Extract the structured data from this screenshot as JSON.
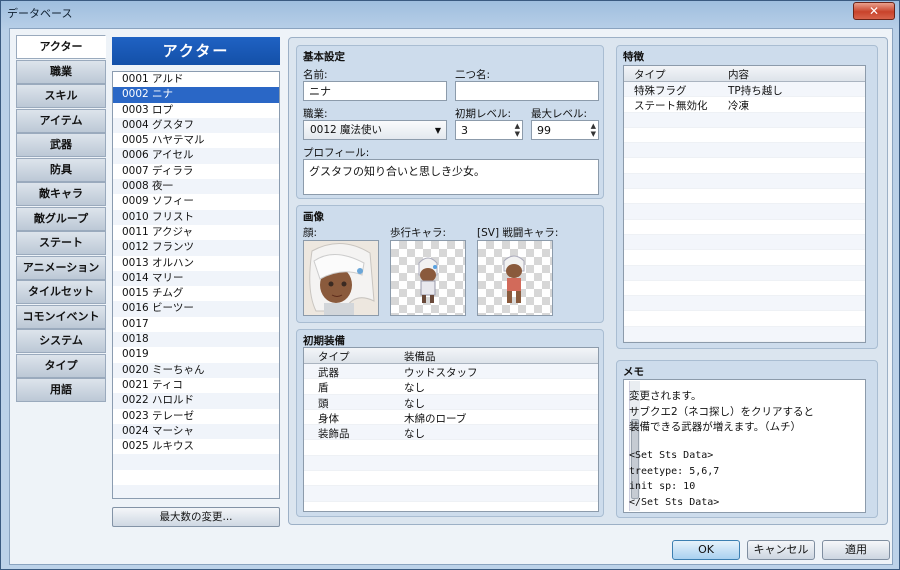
{
  "window": {
    "title": "データベース",
    "close": "✕"
  },
  "categories": [
    "アクター",
    "職業",
    "スキル",
    "アイテム",
    "武器",
    "防具",
    "敵キャラ",
    "敵グループ",
    "ステート",
    "アニメーション",
    "タイルセット",
    "コモンイベント",
    "システム",
    "タイプ",
    "用語"
  ],
  "list": {
    "header": "アクター",
    "selected_index": 1,
    "rows": [
      "0001 アルド",
      "0002 ニナ",
      "0003 ロプ",
      "0004 グスタフ",
      "0005 ハヤテマル",
      "0006 アイセル",
      "0007 ディララ",
      "0008 夜一",
      "0009 ソフィー",
      "0010 フリスト",
      "0011 アクジャ",
      "0012 フランツ",
      "0013 オルハン",
      "0014 マリー",
      "0015 チムグ",
      "0016 ビーツー",
      "0017",
      "0018",
      "0019",
      "0020 ミーちゃん",
      "0021 ティコ",
      "0022 ハロルド",
      "0023 テレーゼ",
      "0024 マーシャ",
      "0025 ルキウス"
    ],
    "max_button": "最大数の変更..."
  },
  "basic": {
    "title": "基本設定",
    "name_label": "名前:",
    "name_value": "ニナ",
    "nick_label": "二つ名:",
    "nick_value": "",
    "class_label": "職業:",
    "class_value": "0012 魔法使い",
    "init_level_label": "初期レベル:",
    "init_level_value": "3",
    "max_level_label": "最大レベル:",
    "max_level_value": "99",
    "profile_label": "プロフィール:",
    "profile_value": "グスタフの知り合いと思しき少女。"
  },
  "images": {
    "title": "画像",
    "face_label": "顔:",
    "walk_label": "歩行キャラ:",
    "sv_label": "[SV] 戦闘キャラ:"
  },
  "equip": {
    "title": "初期装備",
    "col_type": "タイプ",
    "col_item": "装備品",
    "rows": [
      {
        "type": "武器",
        "item": "ウッドスタッフ"
      },
      {
        "type": "盾",
        "item": "なし"
      },
      {
        "type": "頭",
        "item": "なし"
      },
      {
        "type": "身体",
        "item": "木綿のローブ"
      },
      {
        "type": "装飾品",
        "item": "なし"
      }
    ]
  },
  "traits": {
    "title": "特徴",
    "col_type": "タイプ",
    "col_content": "内容",
    "rows": [
      {
        "type": "特殊フラグ",
        "content": "TP持ち越し"
      },
      {
        "type": "ステート無効化",
        "content": "冷凍"
      }
    ]
  },
  "memo": {
    "title": "メモ",
    "lines": [
      "変更されます。",
      "サブクエ2（ネコ探し）をクリアすると",
      "装備できる武器が増えます。（ムチ）",
      "",
      "<Set Sts Data>",
      "treetype: 5,6,7",
      "init sp: 10",
      "</Set Sts Data>"
    ]
  },
  "buttons": {
    "ok": "OK",
    "cancel": "キャンセル",
    "apply": "適用"
  }
}
